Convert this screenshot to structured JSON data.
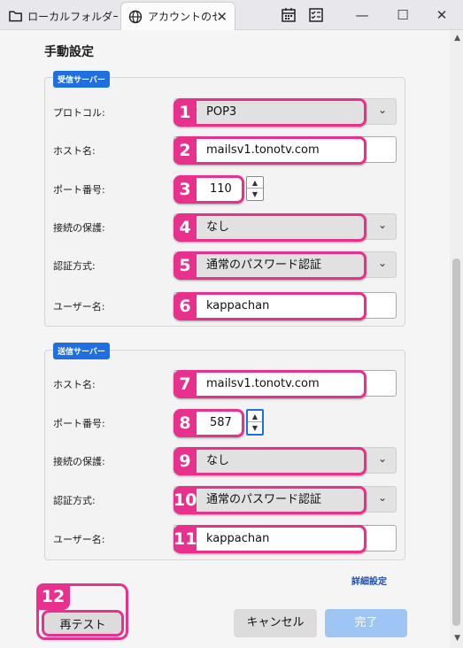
{
  "tabs": [
    {
      "label": "ローカルフォルダー",
      "icon": "folder-icon"
    },
    {
      "label": "アカウントのセットアップ",
      "icon": "globe-icon"
    }
  ],
  "toolbar": {
    "calendar_icon": "calendar-icon",
    "tasks_icon": "tasks-icon"
  },
  "window": {
    "minimize": "—",
    "maximize": "☐",
    "close": "✕"
  },
  "section_title": "手動設定",
  "incoming": {
    "badge": "受信サーバー",
    "protocol": {
      "label": "プロトコル:",
      "value": "POP3",
      "num": "1"
    },
    "host": {
      "label": "ホスト名:",
      "value": "mailsv1.tonotv.com",
      "num": "2"
    },
    "port": {
      "label": "ポート番号:",
      "value": "110",
      "num": "3"
    },
    "security": {
      "label": "接続の保護:",
      "value": "なし",
      "num": "4"
    },
    "auth": {
      "label": "認証方式:",
      "value": "通常のパスワード認証",
      "num": "5"
    },
    "user": {
      "label": "ユーザー名:",
      "value": "kappachan",
      "num": "6"
    }
  },
  "outgoing": {
    "badge": "送信サーバー",
    "host": {
      "label": "ホスト名:",
      "value": "mailsv1.tonotv.com",
      "num": "7"
    },
    "port": {
      "label": "ポート番号:",
      "value": "587",
      "num": "8"
    },
    "security": {
      "label": "接続の保護:",
      "value": "なし",
      "num": "9"
    },
    "auth": {
      "label": "認証方式:",
      "value": "通常のパスワード認証",
      "num": "10"
    },
    "user": {
      "label": "ユーザー名:",
      "value": "kappachan",
      "num": "11"
    }
  },
  "advanced_link": "詳細設定",
  "buttons": {
    "retest": "再テスト",
    "retest_num": "12",
    "cancel": "キャンセル",
    "done": "完了"
  },
  "colors": {
    "highlight": "#e8318c",
    "accent": "#1f6fe0"
  }
}
